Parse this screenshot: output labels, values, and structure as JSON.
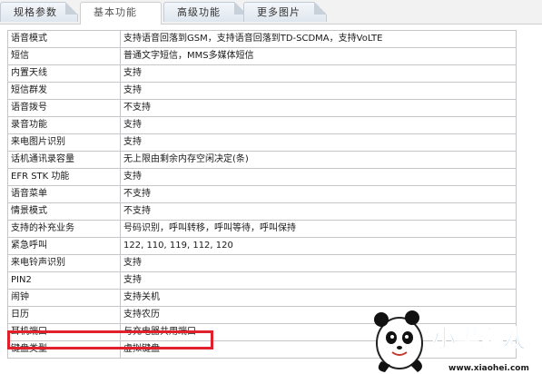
{
  "tabs": [
    {
      "label": "规格参数",
      "active": false
    },
    {
      "label": "基本功能",
      "active": true
    },
    {
      "label": "高级功能",
      "active": false
    },
    {
      "label": "更多图片",
      "active": false
    }
  ],
  "rows": [
    {
      "label": "语音模式",
      "value": "支持语音回落到GSM，支持语音回落到TD-SCDMA，支持VoLTE"
    },
    {
      "label": "短信",
      "value": "普通文字短信，MMS多媒体短信"
    },
    {
      "label": "内置天线",
      "value": "支持"
    },
    {
      "label": "短信群发",
      "value": "支持"
    },
    {
      "label": "语音拨号",
      "value": "不支持"
    },
    {
      "label": "录音功能",
      "value": "支持"
    },
    {
      "label": "来电图片识别",
      "value": "支持"
    },
    {
      "label": "话机通讯录容量",
      "value": "无上限由剩余内存空闲决定(条)"
    },
    {
      "label": "EFR STK 功能",
      "value": "支持"
    },
    {
      "label": "语音菜单",
      "value": "不支持"
    },
    {
      "label": "情景模式",
      "value": "不支持"
    },
    {
      "label": "支持的补充业务",
      "value": "号码识别，呼叫转移，呼叫等待，呼叫保持"
    },
    {
      "label": "紧急呼叫",
      "value": "122, 110, 119, 112, 120"
    },
    {
      "label": "来电铃声识别",
      "value": "支持"
    },
    {
      "label": "PIN2",
      "value": "支持"
    },
    {
      "label": "闹钟",
      "value": "支持关机"
    },
    {
      "label": "日历",
      "value": "支持农历"
    },
    {
      "label": "耳机端口",
      "value": "与充电器共用端口"
    },
    {
      "label": "键盘类型",
      "value": "虚拟键盘"
    }
  ],
  "watermark": {
    "logo_text": "小黑游戏",
    "url": "www.xiaohei.com"
  },
  "colors": {
    "highlight": "#e0202a",
    "logo_blue": "#1e7fd6"
  },
  "icons": [
    "panda-mascot-icon"
  ]
}
